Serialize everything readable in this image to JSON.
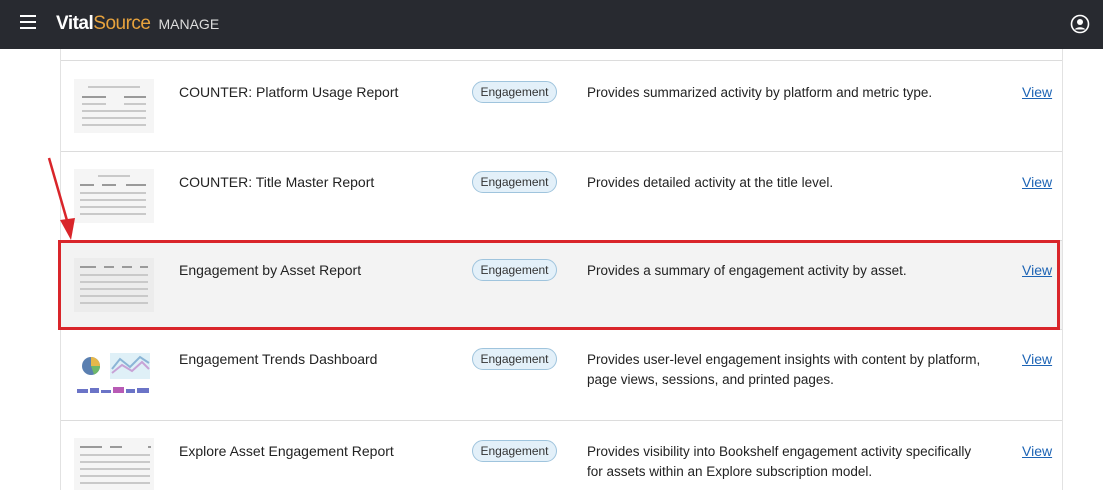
{
  "header": {
    "brand_part1": "Vital",
    "brand_part2": "Source",
    "brand_part3": "MANAGE"
  },
  "reports": [
    {
      "title": "COUNTER: Platform Usage Report",
      "badge": "Engagement",
      "description": "Provides summarized activity by platform and metric type.",
      "link": "View"
    },
    {
      "title": "COUNTER: Title Master Report",
      "badge": "Engagement",
      "description": "Provides detailed activity at the title level.",
      "link": "View"
    },
    {
      "title": "Engagement by Asset Report",
      "badge": "Engagement",
      "description": "Provides a summary of engagement activity by asset.",
      "link": "View"
    },
    {
      "title": "Engagement Trends Dashboard",
      "badge": "Engagement",
      "description": "Provides user-level engagement insights with content by platform, page views, sessions, and printed pages.",
      "link": "View"
    },
    {
      "title": "Explore Asset Engagement Report",
      "badge": "Engagement",
      "description": "Provides visibility into Bookshelf engagement activity specifically for assets within an Explore subscription model.",
      "link": "View"
    }
  ],
  "colors": {
    "header_bg": "#282a30",
    "brand_accent": "#e8a33d",
    "badge_bg": "#e3f0f9",
    "badge_border": "#9fc4dd",
    "link": "#1d64b5",
    "highlight": "#d9252a"
  },
  "icons": [
    "hamburger-menu-icon",
    "user-account-icon",
    "annotation-arrow-icon"
  ]
}
